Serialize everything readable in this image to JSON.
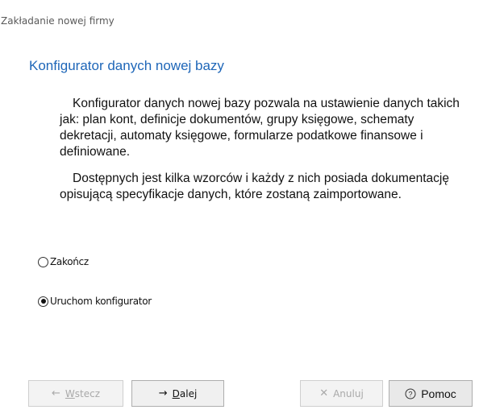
{
  "window": {
    "title": "Zakładanie nowej firmy"
  },
  "page": {
    "title": "Konfigurator danych nowej bazy",
    "paragraph1": "Konfigurator danych nowej bazy pozwala na ustawienie danych takich jak: plan kont, definicje dokumentów, grupy księgowe, schematy dekretacji, automaty księgowe, formularze podatkowe finansowe i definiowane.",
    "paragraph2": "Dostępnych jest kilka wzorców i każdy z nich posiada dokumentację opisującą specyfikacje danych, które zostaną zaimportowane."
  },
  "options": [
    {
      "label": "Zakończ",
      "selected": false
    },
    {
      "label": "Uruchom konfigurator",
      "selected": true
    }
  ],
  "buttons": {
    "back": {
      "label_underlined": "W",
      "label_rest": "stecz",
      "icon": "arrow-left-icon",
      "enabled": false
    },
    "next": {
      "label_underlined": "D",
      "label_rest": "alej",
      "icon": "arrow-right-icon",
      "enabled": true
    },
    "cancel": {
      "label": "Anuluj",
      "icon": "close-icon",
      "enabled": false
    },
    "help": {
      "label": "Pomoc",
      "icon": "question-icon",
      "enabled": true
    }
  }
}
